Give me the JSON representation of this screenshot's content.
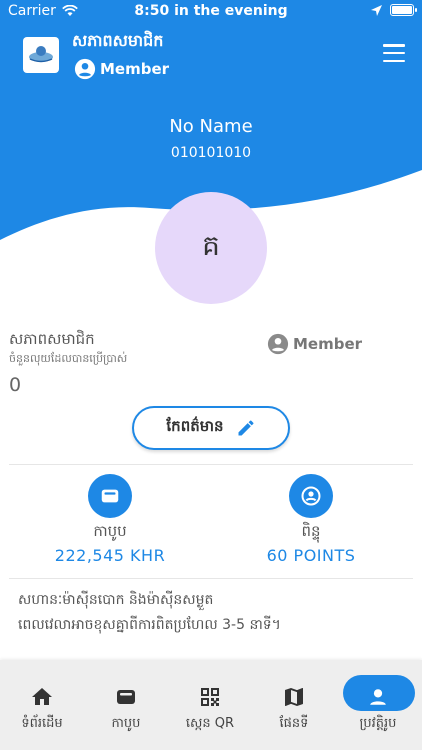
{
  "status_bar": {
    "carrier": "Carrier",
    "time": "8:50 in the evening"
  },
  "header": {
    "title": "សភាពសមាជិក",
    "member_label": "Member",
    "logo_icon": "company-logo",
    "menu_icon": "hamburger-menu-icon"
  },
  "profile": {
    "name": "No Name",
    "phone": "010101010",
    "avatar_initial": "គ"
  },
  "membership": {
    "title": "សភាពសមាជិក",
    "subtitle": "ចំនួនលុយដែលបានប្រើប្រាស់",
    "amount": "0",
    "level": "Member"
  },
  "edit_button": {
    "label": "កែពត៌មាន"
  },
  "wallet": {
    "label": "កាបូប",
    "value": "222,545 KHR"
  },
  "points": {
    "label": "ពិន្ទុ",
    "value": "60 POINTS"
  },
  "notice": {
    "line1": "សហានៈម៉ាស៊ីនបោក និងម៉ាស៊ីនសម្ងួត",
    "line2": "ពេលវេលាអាចខុសគ្នាពីការពិតប្រហែល 3-5 នាទី។"
  },
  "bottom_nav": [
    {
      "label": "ទំព័រដើម",
      "icon": "home-icon"
    },
    {
      "label": "កាបូប",
      "icon": "wallet-icon"
    },
    {
      "label": "ស្កេន QR",
      "icon": "qr-code-icon"
    },
    {
      "label": "ផែនទី",
      "icon": "map-icon"
    },
    {
      "label": "ប្រវត្តិរូប",
      "icon": "profile-icon",
      "active": true
    }
  ],
  "colors": {
    "primary": "#1e88e5",
    "avatar_bg": "#e6d8fa",
    "nav_bg": "#eeeeee"
  }
}
